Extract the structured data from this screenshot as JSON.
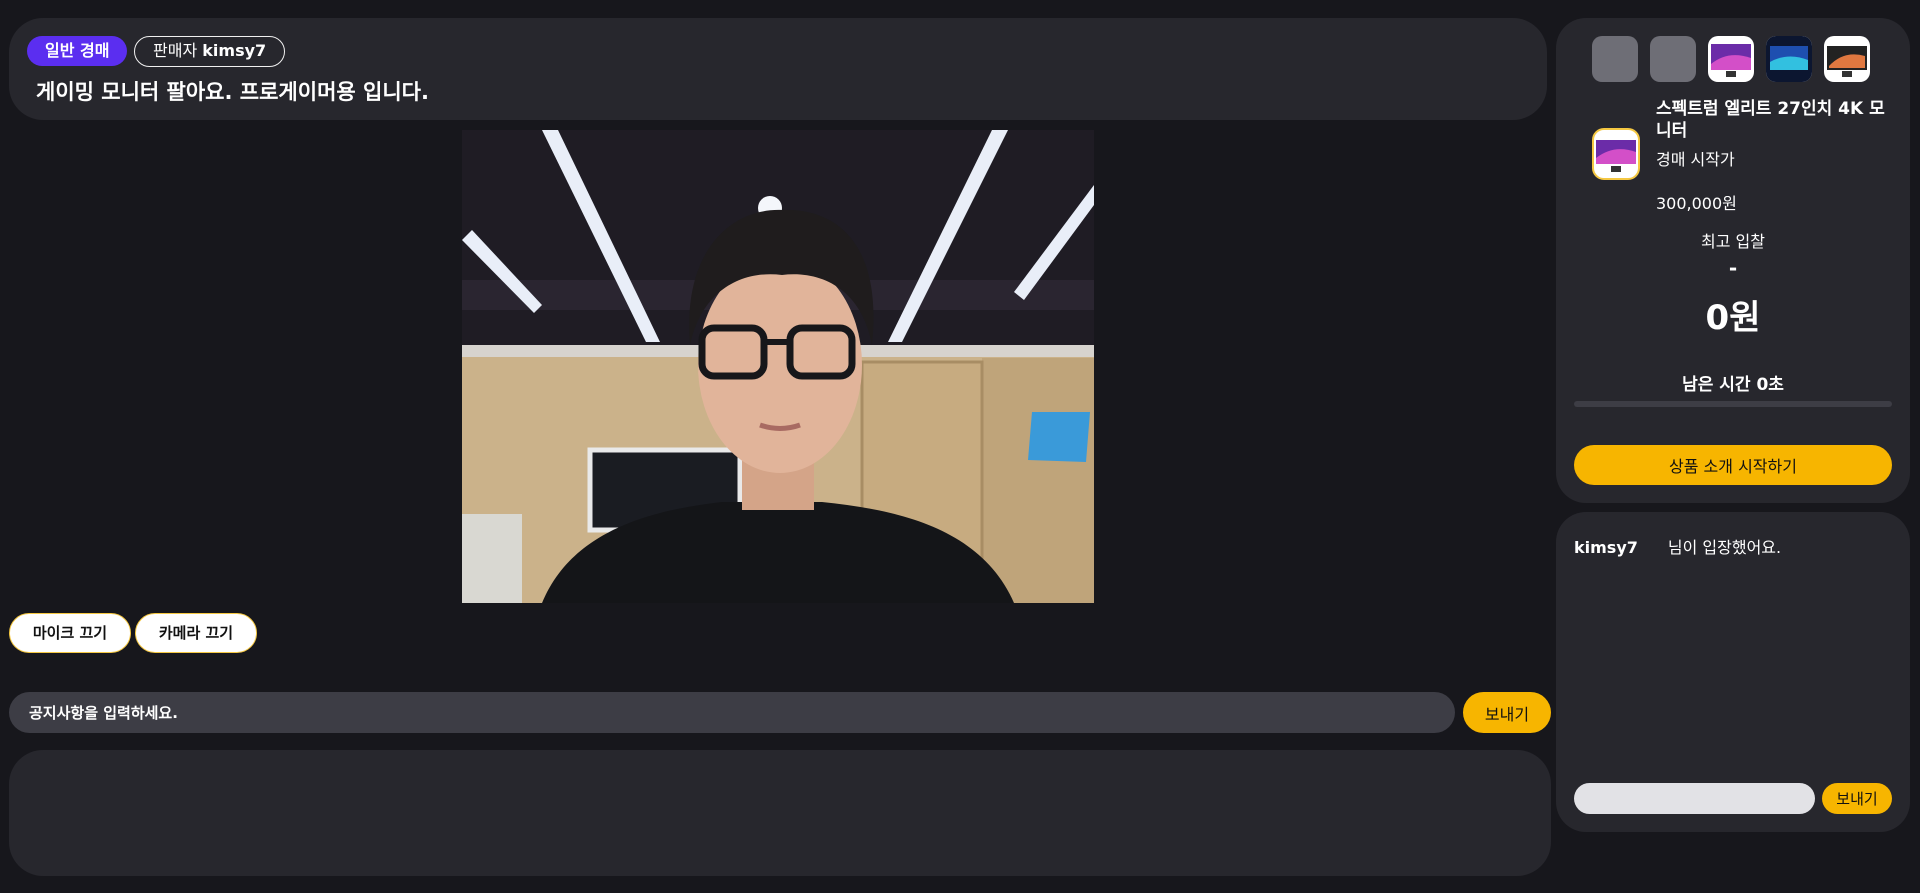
{
  "header": {
    "auction_type": "일반 경매",
    "seller_label": "판매자",
    "seller_name": "kimsy7",
    "title": "게이밍 모니터 팔아요. 프로게이머용 입니다."
  },
  "media": {
    "mic_off_label": "마이크 끄기",
    "camera_off_label": "카메라 끄기"
  },
  "notice": {
    "placeholder": "공지사항을 입력하세요.",
    "send_label": "보내기"
  },
  "product": {
    "name": "스펙트럼 엘리트 27인치 4K 모니터",
    "start_price_label": "경매 시작가",
    "start_price": "300,000원",
    "top_bid_label": "최고 입찰",
    "top_bidder": "-",
    "top_bid_amount": "0원",
    "remaining_time": "남은 시간 0초",
    "remaining_progress": 0,
    "start_intro_label": "상품 소개 시작하기"
  },
  "chat": {
    "messages": [
      {
        "user": "kimsy7",
        "text": "님이 입장했어요."
      }
    ],
    "send_label": "보내기"
  },
  "colors": {
    "background": "#17171c",
    "panel": "#27272d",
    "accent": "#f7b500",
    "badge": "#5b2ef0"
  }
}
